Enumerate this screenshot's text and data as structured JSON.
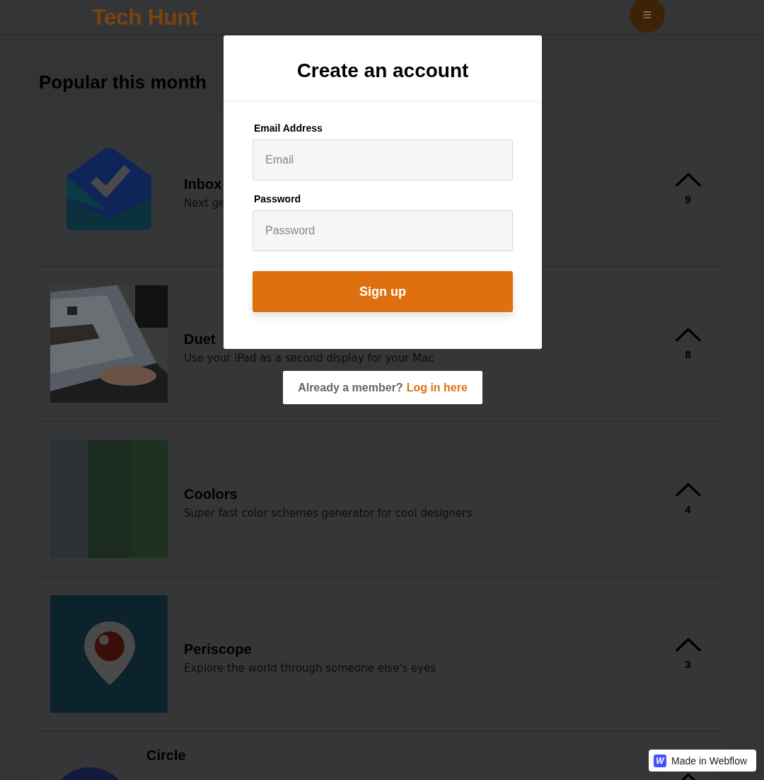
{
  "header": {
    "logo": "Tech Hunt",
    "menu_icon": "≡"
  },
  "section_title": "Popular this month",
  "products": [
    {
      "kind": "envelope",
      "name": "Inbox",
      "tagline": "Next ge",
      "votes": "9"
    },
    {
      "name": "Duet",
      "tagline": "Use your iPad as a second display for your Mac",
      "votes": "8"
    },
    {
      "kind": "palette",
      "name": "Coolors",
      "tagline": "Super fast color schemes generator for cool designers",
      "votes": "4"
    },
    {
      "kind": "pin",
      "name": "Periscope",
      "tagline": "Explore the world through someone else's eyes",
      "votes": "3"
    },
    {
      "kind": "circle",
      "name": "Circle"
    }
  ],
  "modal": {
    "title": "Create an account",
    "fields": [
      {
        "label": "Email Address",
        "placeholder": "Email"
      },
      {
        "label": "Password",
        "placeholder": "Password"
      }
    ],
    "submit": "Sign up"
  },
  "login_prompt": {
    "text": "Already a member?",
    "link": "Log in here"
  },
  "badge": {
    "logo": "W",
    "text": "Made in Webflow"
  }
}
